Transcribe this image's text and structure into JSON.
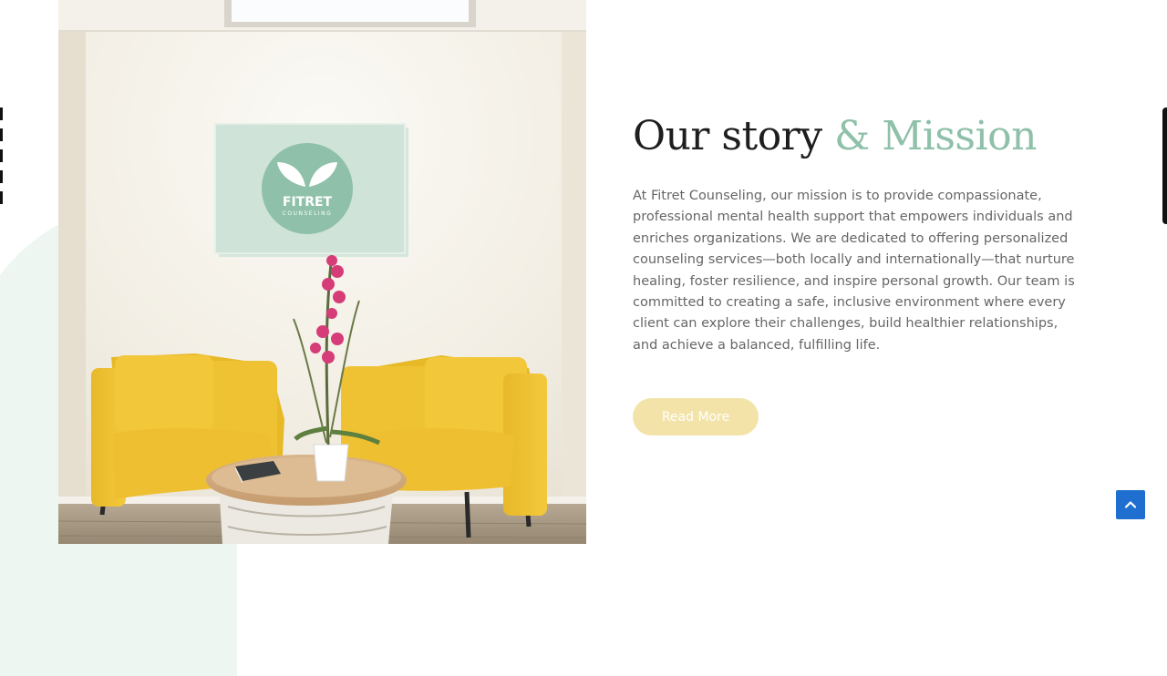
{
  "heading": {
    "main": "Our story",
    "accent": "& Mission"
  },
  "description": "At Fitret Counseling, our mission is to provide compassionate, professional mental health support that empowers individuals and enriches organizations. We are dedicated to offering personalized counseling services—both locally and internationally—that nurture healing, foster resilience, and inspire personal growth. Our team is committed to creating a safe, inclusive environment where every client can explore their challenges, build healthier relationships, and achieve a balanced, fulfilling life.",
  "read_more_label": "Read More",
  "logo": {
    "name": "FITRET",
    "tagline": "COUNSELING"
  },
  "colors": {
    "accent": "#8fc0a9",
    "button": "#f3e3a8",
    "scroll_top": "#1f6fd0"
  },
  "icons": {
    "scroll_top": "chevron-up-icon",
    "logo_mark": "leaf-icon"
  }
}
